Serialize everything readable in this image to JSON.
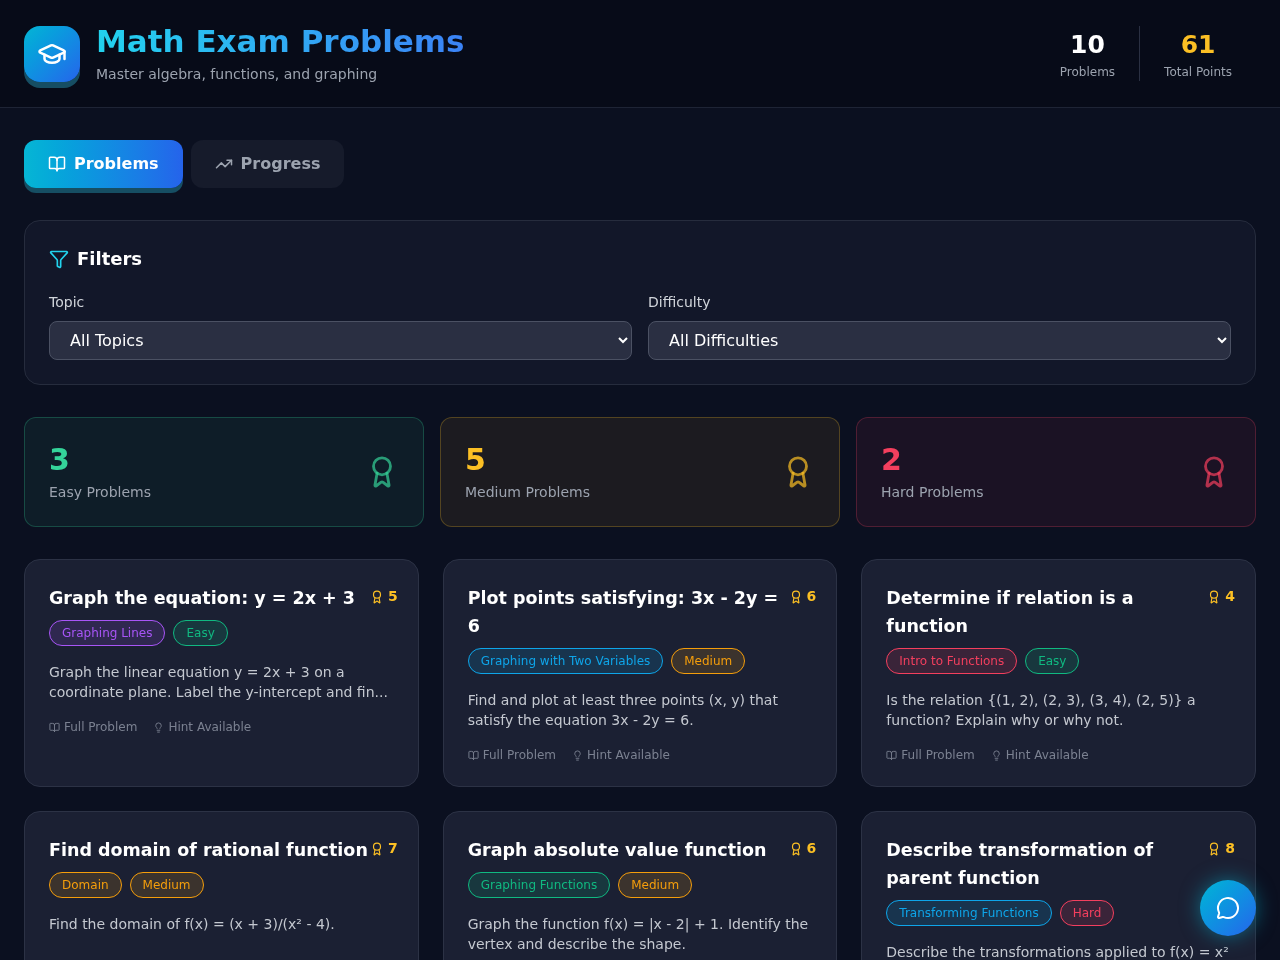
{
  "header": {
    "title": "Math Exam Problems",
    "subtitle": "Master algebra, functions, and graphing",
    "stats": [
      {
        "value": "10",
        "label": "Problems",
        "color": "#ffffff"
      },
      {
        "value": "61",
        "label": "Total Points",
        "color": "#fbbf24"
      }
    ]
  },
  "tabs": [
    {
      "label": "Problems",
      "selected": true
    },
    {
      "label": "Progress",
      "selected": false
    }
  ],
  "filters": {
    "title": "Filters",
    "fields": [
      {
        "label": "Topic",
        "value": "All Topics"
      },
      {
        "label": "Difficulty",
        "value": "All Difficulties"
      }
    ]
  },
  "summary": [
    {
      "count": "3",
      "label": "Easy Problems",
      "color": "#34d399"
    },
    {
      "count": "5",
      "label": "Medium Problems",
      "color": "#fbbf24"
    },
    {
      "count": "2",
      "label": "Hard Problems",
      "color": "#f43f5e"
    }
  ],
  "problems": [
    {
      "title": "Graph the equation: y = 2x + 3",
      "points": "5",
      "tags": [
        {
          "text": "Graphing Lines",
          "color": "#a855f7"
        },
        {
          "text": "Easy",
          "color": "#10b981"
        }
      ],
      "description": "Graph the linear equation y = 2x + 3 on a coordinate plane. Label the y-intercept and fin...",
      "footer": [
        "Full Problem",
        "Hint Available"
      ]
    },
    {
      "title": "Plot points satisfying: 3x - 2y = 6",
      "points": "6",
      "tags": [
        {
          "text": "Graphing with Two Variables",
          "color": "#0ea5e9"
        },
        {
          "text": "Medium",
          "color": "#f59e0b"
        }
      ],
      "description": "Find and plot at least three points (x, y) that satisfy the equation 3x - 2y = 6.",
      "footer": [
        "Full Problem",
        "Hint Available"
      ]
    },
    {
      "title": "Determine if relation is a function",
      "points": "4",
      "tags": [
        {
          "text": "Intro to Functions",
          "color": "#f43f5e"
        },
        {
          "text": "Easy",
          "color": "#10b981"
        }
      ],
      "description": "Is the relation {(1, 2), (2, 3), (3, 4), (2, 5)} a function? Explain why or why not.",
      "footer": [
        "Full Problem",
        "Hint Available"
      ]
    },
    {
      "title": "Find domain of rational function",
      "points": "7",
      "tags": [
        {
          "text": "Domain",
          "color": "#f59e0b"
        },
        {
          "text": "Medium",
          "color": "#f59e0b"
        }
      ],
      "description": "Find the domain of f(x) = (x + 3)/(x² - 4)."
    },
    {
      "title": "Graph absolute value function",
      "points": "6",
      "tags": [
        {
          "text": "Graphing Functions",
          "color": "#10b981"
        },
        {
          "text": "Medium",
          "color": "#f59e0b"
        }
      ],
      "description": "Graph the function f(x) = |x - 2| + 1. Identify the vertex and describe the shape."
    },
    {
      "title": "Describe transformation of parent function",
      "points": "8",
      "tags": [
        {
          "text": "Transforming Functions",
          "color": "#0ea5e9"
        },
        {
          "text": "Hard",
          "color": "#f43f5e"
        }
      ],
      "description": "Describe the transformations applied to f(x) = x²"
    }
  ]
}
